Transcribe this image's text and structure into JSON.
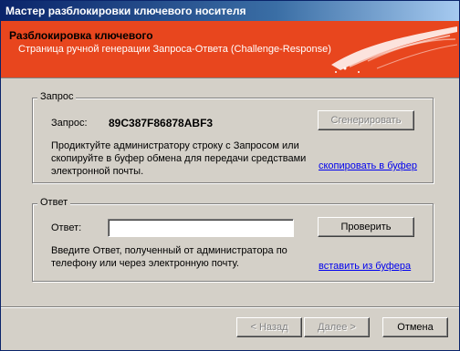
{
  "window": {
    "title": "Мастер разблокировки ключевого носителя"
  },
  "header": {
    "title": "Разблокировка ключевого",
    "subtitle": "Страница ручной генерации Запроса-Ответа (Challenge-Response)"
  },
  "request_group": {
    "title": "Запрос",
    "label": "Запрос:",
    "value": "89C387F86878ABF3",
    "generate_label": "Сгенерировать",
    "description_line1": "Продиктуйте администратору строку с Запросом или",
    "description_line2": "скопируйте в буфер обмена для передачи средствами",
    "description_line3": "электронной почты.",
    "copy_link": "скопировать в буфер"
  },
  "response_group": {
    "title": "Ответ",
    "label": "Ответ:",
    "input_value": "",
    "check_label": "Проверить",
    "description_line1": "Введите Ответ, полученный от администратора по",
    "description_line2": "телефону или через электронную почту.",
    "paste_link": "вставить из буфера"
  },
  "footer": {
    "back_label": "< Назад",
    "next_label": "Далее >",
    "cancel_label": "Отмена"
  }
}
